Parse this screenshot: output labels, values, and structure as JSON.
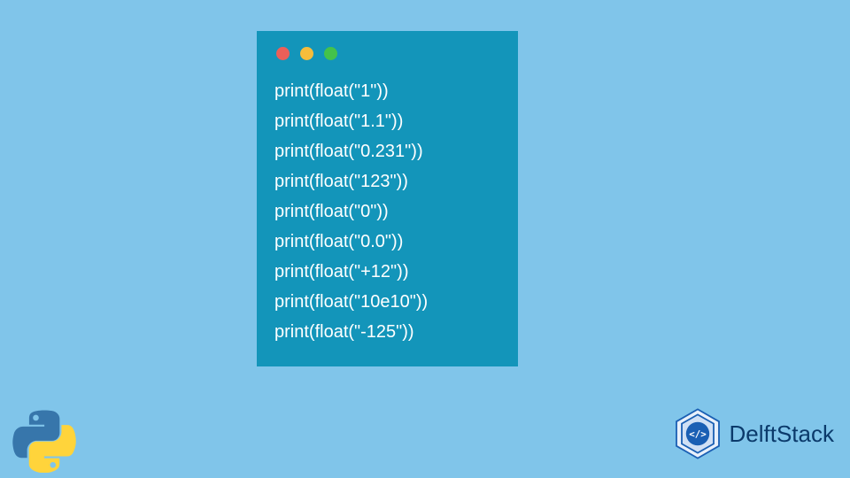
{
  "code": {
    "lines": [
      "print(float(\"1\"))",
      "print(float(\"1.1\"))",
      "print(float(\"0.231\"))",
      "print(float(\"123\"))",
      "print(float(\"0\"))",
      "print(float(\"0.0\"))",
      "print(float(\"+12\"))",
      "print(float(\"10e10\"))",
      "print(float(\"-125\"))"
    ]
  },
  "branding": {
    "site_name": "DelftStack"
  },
  "colors": {
    "background": "#80c5ea",
    "window": "#1395ba",
    "brand_text": "#0b3a6b"
  }
}
